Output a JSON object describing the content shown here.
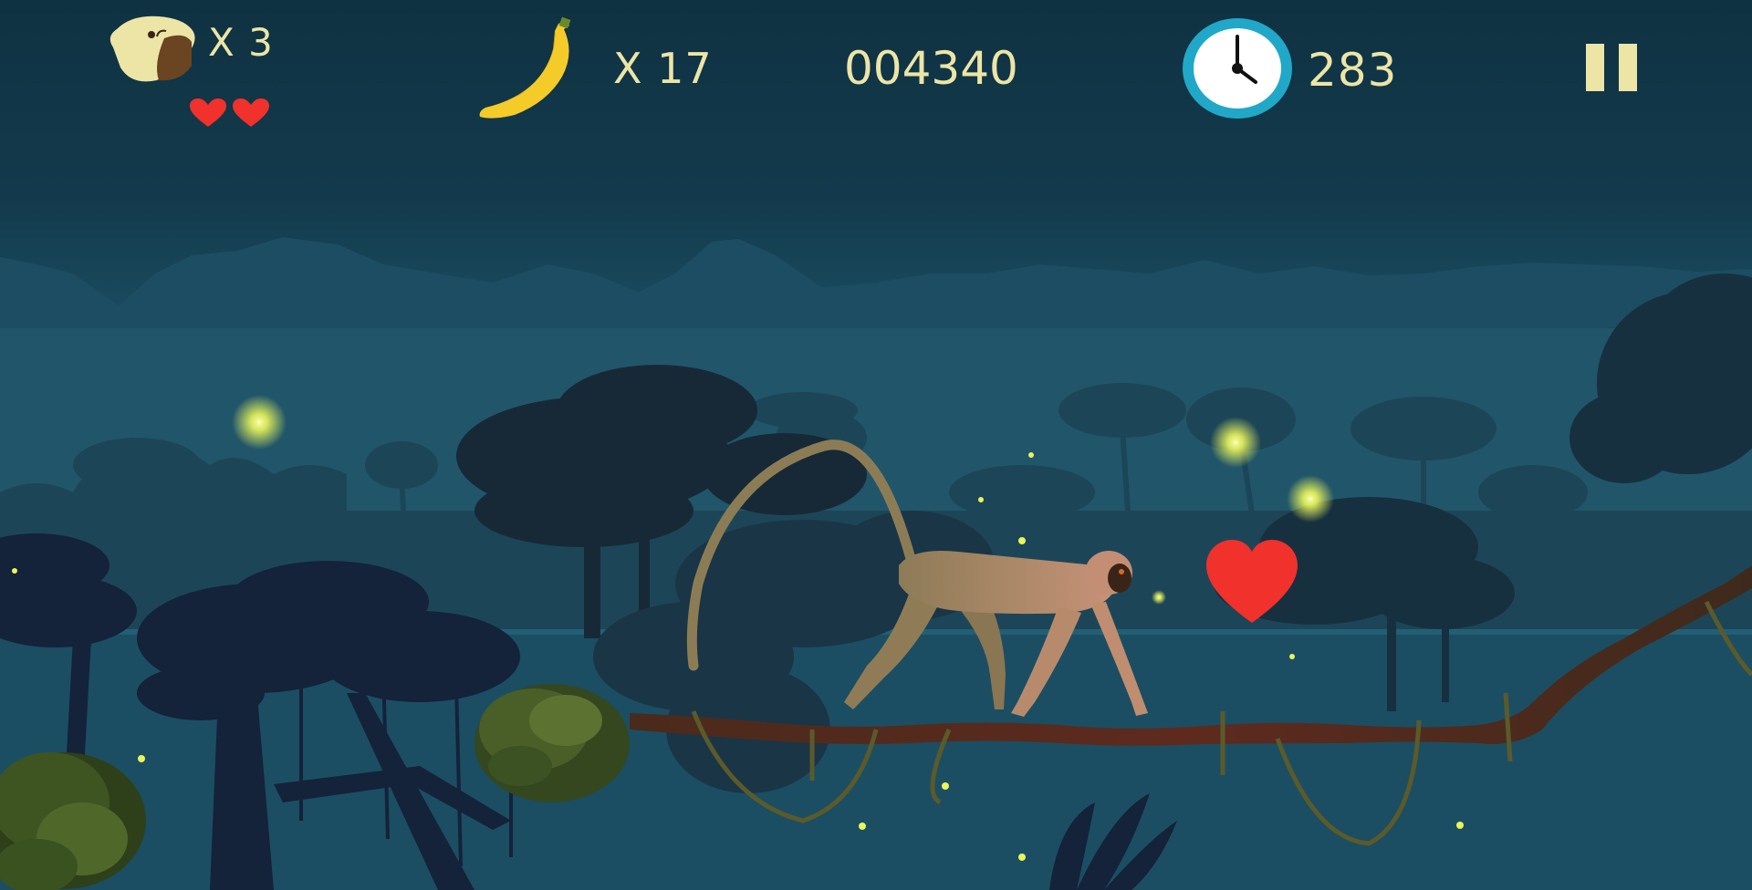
{
  "hud": {
    "lives_label": "X 3",
    "bananas_label": "X 17",
    "score": "004340",
    "timer": "283"
  },
  "icons": {
    "player": "monkey-head-icon",
    "health": "heart-icon",
    "bananas": "banana-icon",
    "timer": "clock-icon",
    "pause": "pause-icon"
  },
  "colors": {
    "hud_text": "#ece5a6",
    "heart": "#f0312c",
    "firefly": "#f4ff6a",
    "clock_ring": "#21a8c8",
    "sky_top": "#0f3242",
    "sky_bottom": "#215a70"
  }
}
